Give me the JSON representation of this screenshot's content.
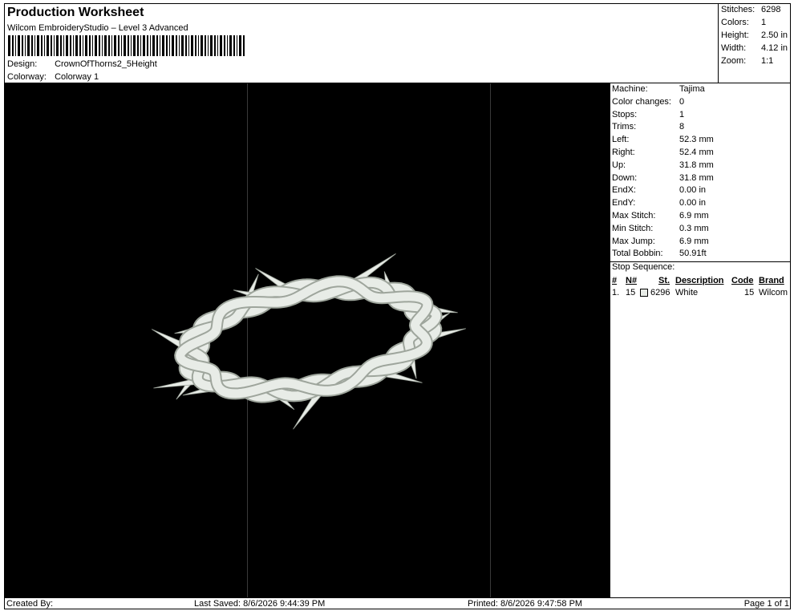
{
  "header": {
    "title": "Production Worksheet",
    "subtitle": "Wilcom EmbroideryStudio – Level 3 Advanced",
    "design_label": "Design:",
    "design_value": "CrownOfThorns2_5Height",
    "colorway_label": "Colorway:",
    "colorway_value": "Colorway 1"
  },
  "summary": {
    "stitches_label": "Stitches:",
    "stitches": "6298",
    "colors_label": "Colors:",
    "colors": "1",
    "height_label": "Height:",
    "height": "2.50 in",
    "width_label": "Width:",
    "width": "4.12 in",
    "zoom_label": "Zoom:",
    "zoom": "1:1"
  },
  "machine_info": [
    {
      "label": "Machine:",
      "value": "Tajima"
    },
    {
      "label": "Color changes:",
      "value": "0"
    },
    {
      "label": "Stops:",
      "value": "1"
    },
    {
      "label": "Trims:",
      "value": "8"
    },
    {
      "label": "Left:",
      "value": "52.3 mm"
    },
    {
      "label": "Right:",
      "value": "52.4 mm"
    },
    {
      "label": "Up:",
      "value": "31.8 mm"
    },
    {
      "label": "Down:",
      "value": "31.8 mm"
    },
    {
      "label": "EndX:",
      "value": "0.00 in"
    },
    {
      "label": "EndY:",
      "value": "0.00 in"
    },
    {
      "label": "Max Stitch:",
      "value": "6.9 mm"
    },
    {
      "label": "Min Stitch:",
      "value": "0.3 mm"
    },
    {
      "label": "Max Jump:",
      "value": "6.9 mm"
    },
    {
      "label": "Total Bobbin:",
      "value": "50.91ft"
    }
  ],
  "stop_sequence": {
    "title": "Stop Sequence:",
    "headers": {
      "num": "#",
      "n": "N#",
      "st": "St.",
      "description": "Description",
      "code": "Code",
      "brand": "Brand"
    },
    "rows": [
      {
        "num": "1.",
        "n": "15",
        "st": "6296",
        "description": "White",
        "code": "15",
        "brand": "Wilcom"
      }
    ]
  },
  "thread_colors": {
    "white": "#e8ece7",
    "shade": "#9ea59c",
    "background": "#000000"
  },
  "footer": {
    "created_by": "Created By:",
    "last_saved": "Last Saved: 8/6/2026 9:44:39 PM",
    "printed": "Printed: 8/6/2026 9:47:58 PM",
    "page": "Page 1 of 1"
  }
}
